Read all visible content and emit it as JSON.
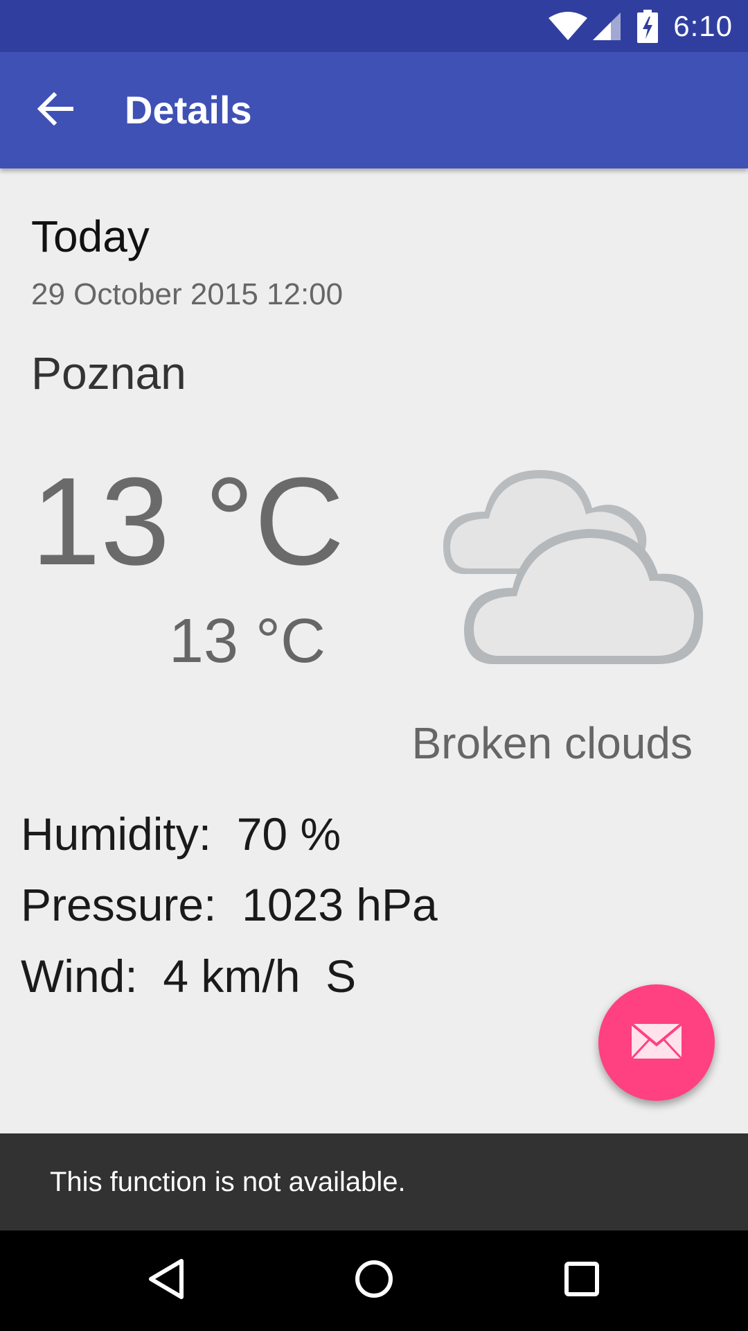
{
  "status_bar": {
    "time": "6:10",
    "icons": [
      "wifi-icon",
      "cell-signal-icon",
      "battery-charging-icon"
    ]
  },
  "app_bar": {
    "title": "Details",
    "back_icon": "arrow-back-icon"
  },
  "forecast": {
    "day": "Today",
    "datetime": "29 October 2015 12:00",
    "city": "Poznan",
    "temp_max": "13 °C",
    "temp_min": "13 °C",
    "condition_icon": "broken-clouds-icon",
    "description": "Broken clouds",
    "humidity": "Humidity:  70 %",
    "pressure": "Pressure:  1023 hPa",
    "wind": "Wind:  4 km/h  S"
  },
  "fab": {
    "icon": "email-icon",
    "color": "#ff4081"
  },
  "snackbar": {
    "message": "This function is not available."
  },
  "nav_bar": {
    "icons": [
      "nav-back-icon",
      "nav-home-icon",
      "nav-recents-icon"
    ]
  },
  "colors": {
    "primary": "#3f51b5",
    "primary_dark": "#303f9f",
    "accent": "#ff4081"
  }
}
